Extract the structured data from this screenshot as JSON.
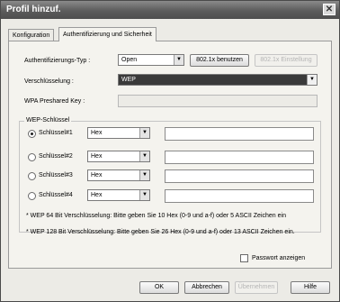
{
  "window": {
    "title": "Profil hinzuf."
  },
  "tabs": [
    {
      "label": "Konfiguration"
    },
    {
      "label": "Authentifizierung und Sicherheit"
    }
  ],
  "auth": {
    "label": "Authentifizierungs-Typ :",
    "value": "Open",
    "button_8021x": "802.1x benutzen",
    "button_8021x_settings": "802.1x Einstellung"
  },
  "encryption": {
    "label": "Verschlüsselung :",
    "value": "WEP"
  },
  "wpa": {
    "label": "WPA Preshared Key :",
    "value": ""
  },
  "wep": {
    "group_label": "WEP-Schlüssel",
    "keys": [
      {
        "label": "Schlüssel#1",
        "format": "Hex",
        "value": ""
      },
      {
        "label": "Schlüssel#2",
        "format": "Hex",
        "value": ""
      },
      {
        "label": "Schlüssel#3",
        "format": "Hex",
        "value": ""
      },
      {
        "label": "Schlüssel#4",
        "format": "Hex",
        "value": ""
      }
    ],
    "notes": [
      "* WEP 64 Bit Verschlüsselung: Bitte geben Sie 10 Hex (0-9 und a-f) oder 5 ASCII Zeichen ein",
      "* WEP 128 Bit Verschlüsselung: Bitte geben Sie 26 Hex (0-9 und a-f) oder 13 ASCII Zeichen ein."
    ],
    "show_password": "Passwort anzeigen"
  },
  "footer": {
    "ok": "OK",
    "cancel": "Abbrechen",
    "apply": "Übernehmen",
    "help": "Hilfe"
  }
}
